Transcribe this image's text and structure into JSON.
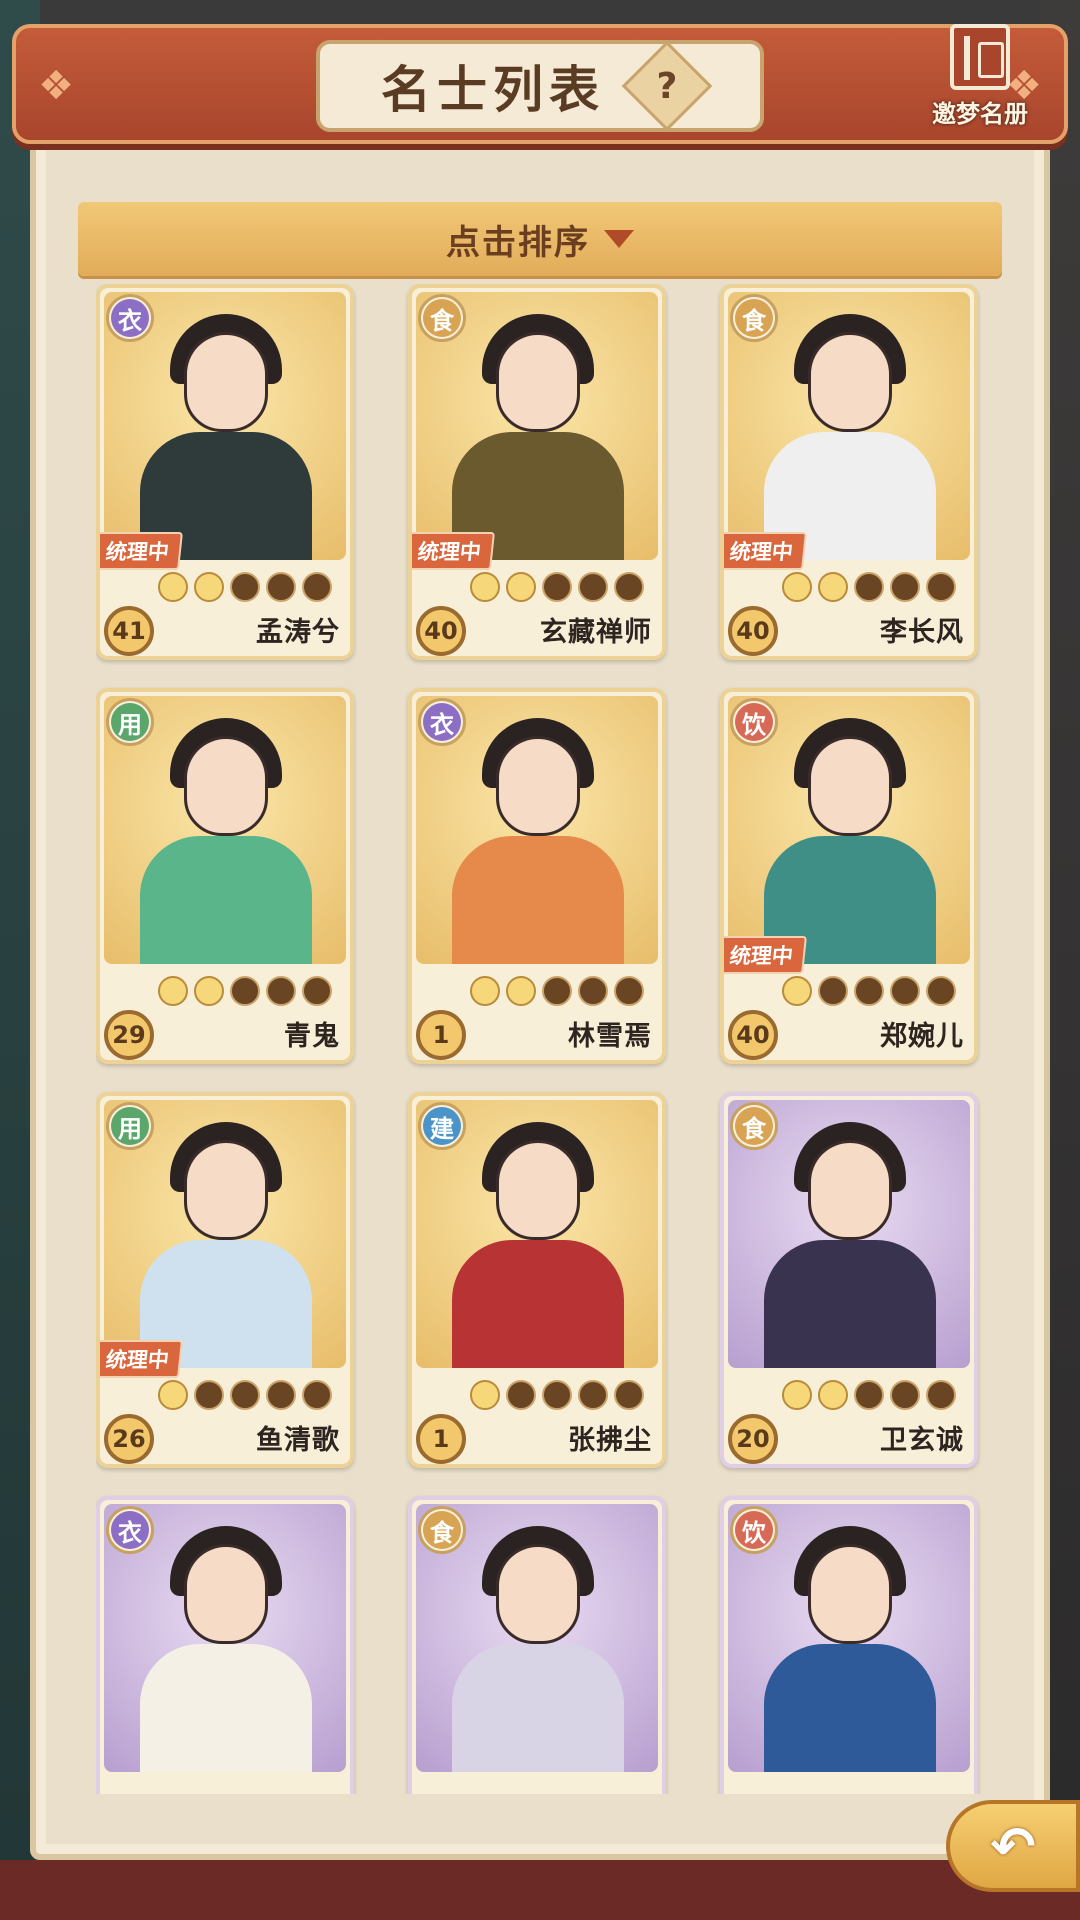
{
  "header": {
    "title": "名士列表",
    "help_label": "?",
    "book_label": "邀梦名册"
  },
  "sort": {
    "label": "点击排序"
  },
  "colors": {
    "衣": "#8c6fc4",
    "食": "#d8a352",
    "用": "#5ba66b",
    "饮": "#d66a56",
    "建": "#4b94c9"
  },
  "characters": [
    {
      "name": "孟涛兮",
      "type": "衣",
      "level": "41",
      "stars": 2,
      "status": "统理中",
      "theme": "gold"
    },
    {
      "name": "玄藏禅师",
      "type": "食",
      "level": "40",
      "stars": 2,
      "status": "统理中",
      "theme": "gold"
    },
    {
      "name": "李长风",
      "type": "食",
      "level": "40",
      "stars": 2,
      "status": "统理中",
      "theme": "gold"
    },
    {
      "name": "青鬼",
      "type": "用",
      "level": "29",
      "stars": 2,
      "status": "",
      "theme": "gold"
    },
    {
      "name": "林雪焉",
      "type": "衣",
      "level": "1",
      "stars": 2,
      "status": "",
      "theme": "gold"
    },
    {
      "name": "郑婉儿",
      "type": "饮",
      "level": "40",
      "stars": 1,
      "status": "统理中",
      "theme": "gold"
    },
    {
      "name": "鱼清歌",
      "type": "用",
      "level": "26",
      "stars": 1,
      "status": "统理中",
      "theme": "gold"
    },
    {
      "name": "张拂尘",
      "type": "建",
      "level": "1",
      "stars": 1,
      "status": "",
      "theme": "gold"
    },
    {
      "name": "卫玄诚",
      "type": "食",
      "level": "20",
      "stars": 2,
      "status": "",
      "theme": "purple"
    },
    {
      "name": "",
      "type": "衣",
      "level": "",
      "stars": 0,
      "status": "",
      "theme": "purple"
    },
    {
      "name": "",
      "type": "食",
      "level": "",
      "stars": 0,
      "status": "",
      "theme": "purple"
    },
    {
      "name": "",
      "type": "饮",
      "level": "",
      "stars": 0,
      "status": "",
      "theme": "purple"
    }
  ]
}
